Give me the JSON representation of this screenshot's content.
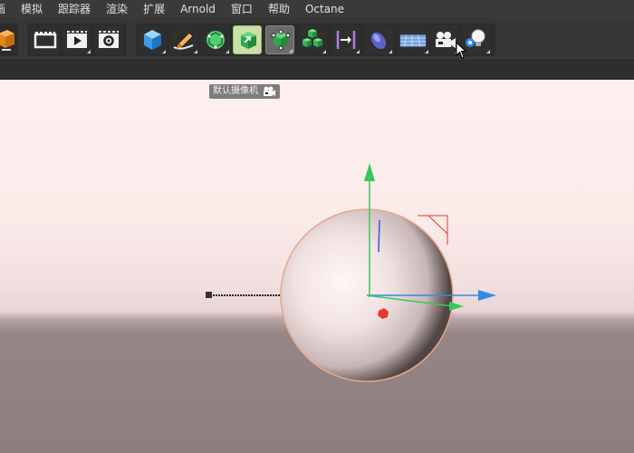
{
  "menu": {
    "items": [
      "画",
      "模拟",
      "跟踪器",
      "渲染",
      "扩展",
      "Arnold",
      "窗口",
      "帮助",
      "Octane"
    ]
  },
  "toolbar": {
    "buttons": [
      {
        "icon": "cube-icon"
      },
      {
        "icon": "render-region-icon"
      },
      {
        "icon": "render-view-icon"
      },
      {
        "icon": "render-settings-icon"
      },
      {
        "icon": "primitive-cube-icon"
      },
      {
        "icon": "spline-pen-icon"
      },
      {
        "icon": "subdivision-icon"
      },
      {
        "icon": "generator-icon"
      },
      {
        "icon": "array-icon"
      },
      {
        "icon": "cloner-icon"
      },
      {
        "icon": "deformer-icon"
      },
      {
        "icon": "field-icon"
      },
      {
        "icon": "floor-icon"
      },
      {
        "icon": "camera-icon"
      },
      {
        "icon": "light-icon"
      }
    ]
  },
  "tooltip": {
    "text": "默认摄像机"
  },
  "colors": {
    "accent_green": "#36c95a",
    "axis_blue": "#2f8ce6",
    "axis_red": "#e23a2f"
  }
}
